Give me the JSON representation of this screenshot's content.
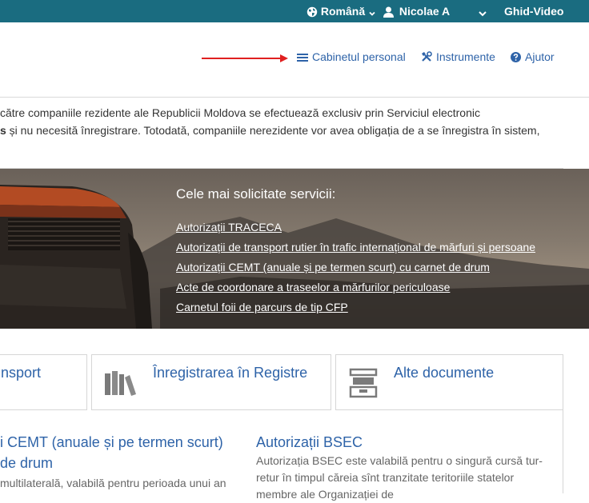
{
  "topbar": {
    "language": "Română",
    "user": "Nicolae A",
    "video": "Ghid-Video",
    "colors": {
      "bar": "#1a6c80"
    }
  },
  "nav": {
    "cabinet": "Cabinetul personal",
    "tools": "Instrumente",
    "help": "Ajutor"
  },
  "notice": {
    "line1": "către companiile rezidente ale Republicii Moldova se efectuează exclusiv prin Serviciul electronic",
    "line2_bold": "s",
    "line2": " și nu necesită înregistrare. Totodată, companiile nerezidente vor avea obligația de a se înregistra în sistem,"
  },
  "hero": {
    "title": "Cele mai solicitate servicii:",
    "links": [
      "Autorizații TRACECA",
      "Autorizații de transport rutier în trafic internațional de mărfuri și persoane",
      "Autorizații CEMT (anuale și pe termen scurt) cu carnet de drum",
      "Acte de coordonare a traseelor a mărfurilor periculoase",
      "Carnetul foii de parcurs de tip CFP"
    ]
  },
  "cards": {
    "transport": "nsport",
    "registre": "Înregistrarea în Registre",
    "documente": "Alte documente"
  },
  "articles": {
    "cemt": {
      "title1": "i CEMT (anuale și pe termen scurt)",
      "title2": "de drum",
      "text1": "multilaterală, valabilă pentru perioada unui an"
    },
    "bsec": {
      "title": "Autorizații BSEC",
      "text1": "Autorizația BSEC este valabilă pentru o singură cursă tur-",
      "text2": "retur în timpul căreia sînt tranzitate teritoriile statelor",
      "text3": "membre ale Organizației de"
    }
  }
}
